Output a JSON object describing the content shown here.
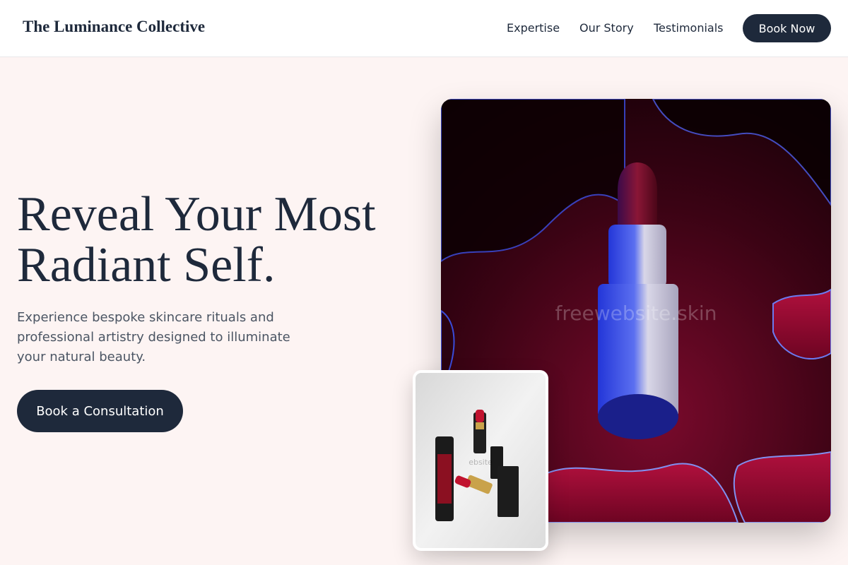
{
  "header": {
    "brand": "The Luminance Collective",
    "nav": [
      {
        "label": "Expertise"
      },
      {
        "label": "Our Story"
      },
      {
        "label": "Testimonials"
      }
    ],
    "cta_label": "Book Now"
  },
  "hero": {
    "headline_line1": "Reveal Your Most",
    "headline_line2": "Radiant Self.",
    "subtext": "Experience bespoke skincare rituals and professional artistry designed to illuminate your natural beauty.",
    "cta_label": "Book a Consultation",
    "image_watermark": "freewebsite.skin",
    "thumb_watermark": "ebsite"
  },
  "colors": {
    "primary": "#1e293b",
    "background": "#fdf4f3",
    "text_muted": "#4b5563"
  },
  "icons": {
    "main_image": "lipstick-image",
    "thumbnail": "cosmetics-product-image"
  }
}
